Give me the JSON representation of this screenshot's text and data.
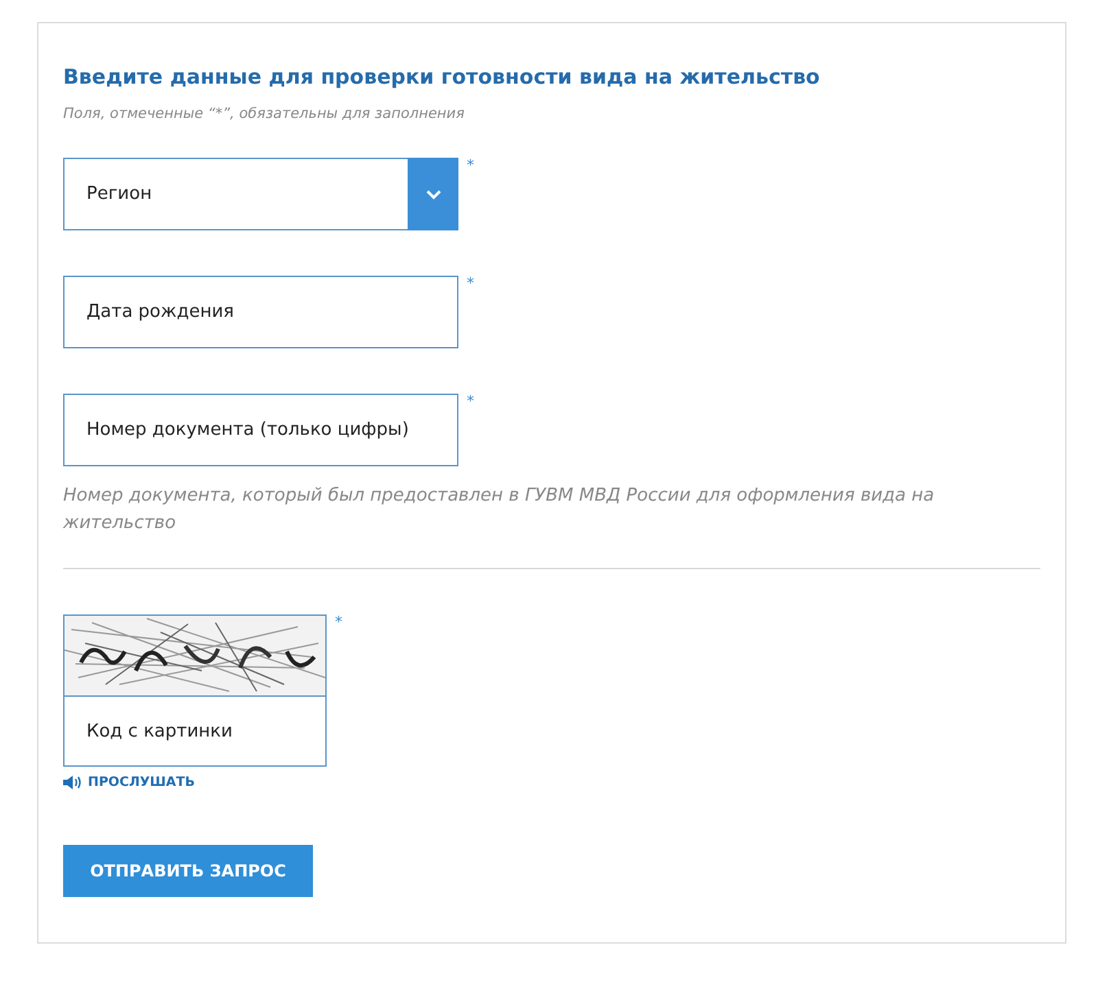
{
  "form": {
    "title": "Введите данные для проверки готовности вида на жительство",
    "note": "Поля, отмеченные “*”, обязательны для заполнения",
    "fields": [
      {
        "kind": "select",
        "placeholder": "Регион",
        "required": true,
        "marker": "*"
      },
      {
        "kind": "text",
        "placeholder": "Дата рождения",
        "required": true,
        "marker": "*"
      },
      {
        "kind": "text",
        "placeholder": "Номер документа (только цифры)",
        "required": true,
        "marker": "*",
        "hint": "Номер документа, который был предоставлен в ГУВМ МВД России для оформления вида на жительство"
      }
    ],
    "captcha": {
      "placeholder": "Код с картинки",
      "required": true,
      "marker": "*",
      "listen": "ПРОСЛУШАТЬ"
    },
    "submit": "ОТПРАВИТЬ ЗАПРОС"
  }
}
